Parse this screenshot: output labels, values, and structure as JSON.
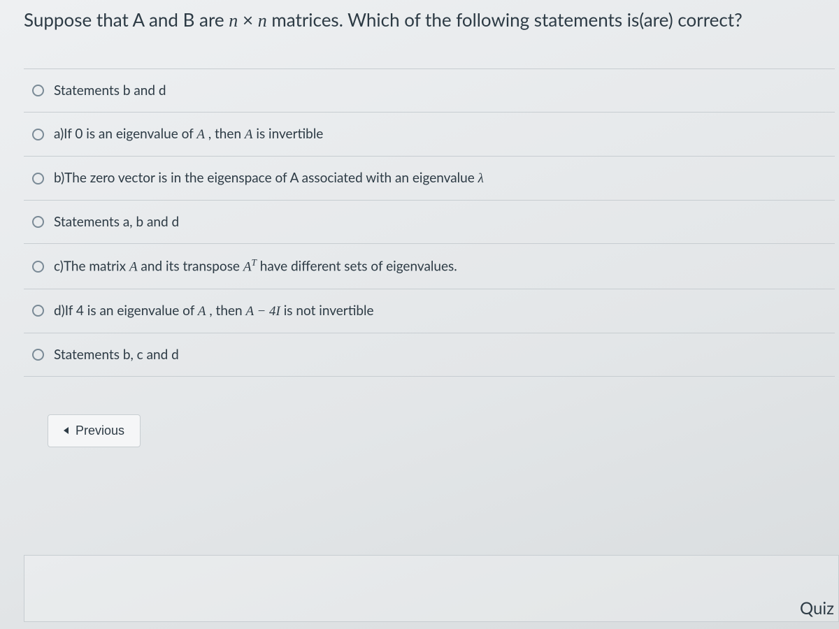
{
  "question": {
    "prefix": "Suppose that A and B are ",
    "mid": " matrices. Which of the following statements is(are) correct?"
  },
  "options": {
    "o1": "Statements b and d",
    "o2_pre": "a)If 0 is an eigenvalue of ",
    "o2_mid": " , then ",
    "o2_post": "  is invertible",
    "o3_pre": "b)The zero vector is in the eigenspace of A associated with an eigenvalue ",
    "o4": "Statements a, b and d",
    "o5_pre": "c)The matrix ",
    "o5_mid": " and its transpose ",
    "o5_post": " have different sets of eigenvalues.",
    "o6_pre": "d)If 4 is an eigenvalue of ",
    "o6_mid": " , then ",
    "o6_post": "   is not invertible",
    "o7": "Statements b, c and d"
  },
  "nav": {
    "previous": "Previous"
  },
  "footer": {
    "quiz": "Quiz"
  },
  "math": {
    "n": "n",
    "times": "×",
    "A": "A",
    "AT_T": "T",
    "Aminus4I": "A − 4I",
    "lambda": "λ"
  }
}
